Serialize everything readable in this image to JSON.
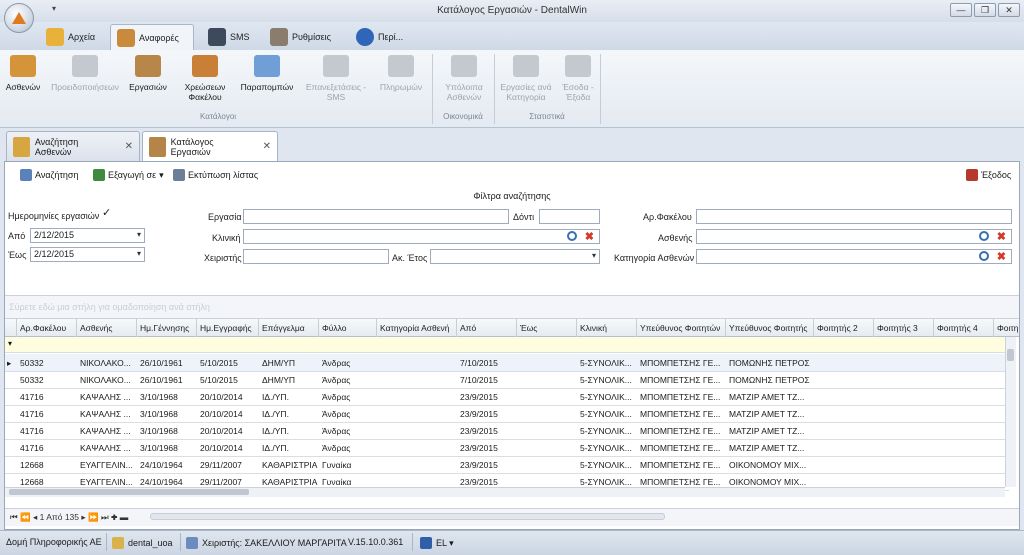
{
  "window": {
    "title": "Κατάλογος Εργασιών - DentalWin",
    "qat": "▾",
    "minimize": "—",
    "restore": "❐",
    "close": "✕"
  },
  "ribbon_tabs": [
    {
      "label": "Αρχεία"
    },
    {
      "label": "Αναφορές"
    },
    {
      "label": "SMS"
    },
    {
      "label": "Ρυθμίσεις"
    },
    {
      "label": "Περί..."
    }
  ],
  "ribbon": {
    "buttons": [
      {
        "label": "Ασθενών"
      },
      {
        "label": "Προειδοποιήσεων"
      },
      {
        "label": "Εργασιών"
      },
      {
        "label": "Χρεώσεων Φακέλου"
      },
      {
        "label": "Παραπομπών"
      },
      {
        "label": "Επανεξετάσεις - SMS"
      },
      {
        "label": "Πληρωμών"
      },
      {
        "label": "Υπόλοιπα Ασθενών"
      },
      {
        "label": "Εργασίες ανά Κατηγορία"
      },
      {
        "label": "Έσοδα - Έξοδα"
      }
    ],
    "groups": {
      "catalogs": "Κατάλογοι",
      "financial": "Οικονομικά",
      "statistics": "Στατιστικά"
    }
  },
  "doc_tabs": [
    {
      "label": "Αναζήτηση Ασθενών",
      "close": "✕"
    },
    {
      "label": "Κατάλογος Εργασιών",
      "close": "✕"
    }
  ],
  "toolbar": {
    "search": "Αναζήτηση",
    "export": "Εξαγωγή σε",
    "export_arrow": "▾",
    "print": "Εκτύπωση λίστας",
    "exit": "Έξοδος"
  },
  "filters": {
    "title": "Φίλτρα αναζήτησης",
    "dates_label": "Ημερομηνίες εργασιών",
    "dates_checked": "✓",
    "from_label": "Από",
    "from_value": "2/12/2015",
    "to_label": "Έως",
    "to_value": "2/12/2015",
    "work_label": "Εργασία",
    "tooth_label": "Δόντι",
    "clinic_label": "Κλινική",
    "operator_label": "Χειριστής",
    "year_label": "Ακ. Έτος",
    "folder_label": "Αρ.Φακέλου",
    "patient_label": "Ασθενής",
    "category_label": "Κατηγορία Ασθενών"
  },
  "grid": {
    "group_hint": "Σύρετε εδώ μια στήλη για ομαδοποίηση ανά στήλη",
    "filter_marker": "▾",
    "columns": [
      "Αρ.Φακέλου",
      "Ασθενής",
      "Ημ.Γέννησης",
      "Ημ.Εγγραφής",
      "Επάγγελμα",
      "Φύλλο",
      "Κατηγορία Ασθενή",
      "Από",
      "Έως",
      "Κλινική",
      "Υπεύθυνος Φοιτητών",
      "Υπεύθυνος Φοιτητής",
      "Φοιτητής 2",
      "Φοιτητής 3",
      "Φοιτητής 4",
      "Φοιτη"
    ],
    "row_marker": "▸",
    "rows": [
      [
        "50332",
        "ΝΙΚΟΛΑΚΟ...",
        "26/10/1961",
        "5/10/2015",
        "ΔΗΜ/ΥΠ",
        "Άνδρας",
        "",
        "7/10/2015",
        "",
        "5-ΣΥΝΟΛΙΚ...",
        "ΜΠΟΜΠΕΤΣΗΣ ΓΕ...",
        "ΠΟΜΩΝΗΣ ΠΕΤΡΟΣ"
      ],
      [
        "50332",
        "ΝΙΚΟΛΑΚΟ...",
        "26/10/1961",
        "5/10/2015",
        "ΔΗΜ/ΥΠ",
        "Άνδρας",
        "",
        "7/10/2015",
        "",
        "5-ΣΥΝΟΛΙΚ...",
        "ΜΠΟΜΠΕΤΣΗΣ ΓΕ...",
        "ΠΟΜΩΝΗΣ ΠΕΤΡΟΣ"
      ],
      [
        "41716",
        "ΚΑΨΑΛΗΣ ...",
        "3/10/1968",
        "20/10/2014",
        "ΙΔ./ΥΠ.",
        "Άνδρας",
        "",
        "23/9/2015",
        "",
        "5-ΣΥΝΟΛΙΚ...",
        "ΜΠΟΜΠΕΤΣΗΣ ΓΕ...",
        "ΜΑΤΖΙΡ ΑΜΕΤ ΤΖ..."
      ],
      [
        "41716",
        "ΚΑΨΑΛΗΣ ...",
        "3/10/1968",
        "20/10/2014",
        "ΙΔ./ΥΠ.",
        "Άνδρας",
        "",
        "23/9/2015",
        "",
        "5-ΣΥΝΟΛΙΚ...",
        "ΜΠΟΜΠΕΤΣΗΣ ΓΕ...",
        "ΜΑΤΖΙΡ ΑΜΕΤ ΤΖ..."
      ],
      [
        "41716",
        "ΚΑΨΑΛΗΣ ...",
        "3/10/1968",
        "20/10/2014",
        "ΙΔ./ΥΠ.",
        "Άνδρας",
        "",
        "23/9/2015",
        "",
        "5-ΣΥΝΟΛΙΚ...",
        "ΜΠΟΜΠΕΤΣΗΣ ΓΕ...",
        "ΜΑΤΖΙΡ ΑΜΕΤ ΤΖ..."
      ],
      [
        "41716",
        "ΚΑΨΑΛΗΣ ...",
        "3/10/1968",
        "20/10/2014",
        "ΙΔ./ΥΠ.",
        "Άνδρας",
        "",
        "23/9/2015",
        "",
        "5-ΣΥΝΟΛΙΚ...",
        "ΜΠΟΜΠΕΤΣΗΣ ΓΕ...",
        "ΜΑΤΖΙΡ ΑΜΕΤ ΤΖ..."
      ],
      [
        "12668",
        "ΕΥΑΓΓΕΛΙΝ...",
        "24/10/1964",
        "29/11/2007",
        "ΚΑΘΑΡΙΣΤΡΙΑ",
        "Γυναίκα",
        "",
        "23/9/2015",
        "",
        "5-ΣΥΝΟΛΙΚ...",
        "ΜΠΟΜΠΕΤΣΗΣ ΓΕ...",
        "ΟΙΚΟΝΟΜΟΥ ΜΙΧ..."
      ],
      [
        "12668",
        "ΕΥΑΓΓΕΛΙΝ...",
        "24/10/1964",
        "29/11/2007",
        "ΚΑΘΑΡΙΣΤΡΙΑ",
        "Γυναίκα",
        "",
        "23/9/2015",
        "",
        "5-ΣΥΝΟΛΙΚ...",
        "ΜΠΟΜΠΕΤΣΗΣ ΓΕ...",
        "ΟΙΚΟΝΟΜΟΥ ΜΙΧ..."
      ]
    ],
    "navigator": "⏮ ⏪ ◂  1 Από 135  ▸ ⏩ ⏭ ✚ ▬"
  },
  "status": {
    "company": "Δομή Πληροφορικής ΑΕ",
    "db": "dental_uoa",
    "operator": "Χειριστής: ΣΑΚΕΛΛΙΟΥ ΜΑΡΓΑΡΙΤΑ",
    "version": "V.15.10.0.361",
    "lang": "EL ▾"
  },
  "colors": {
    "accent": "#3a6fb0",
    "ribbon_bg": "#e4eaf1",
    "selected_row": "#eef3fb",
    "filter_row": "#fffde0"
  }
}
